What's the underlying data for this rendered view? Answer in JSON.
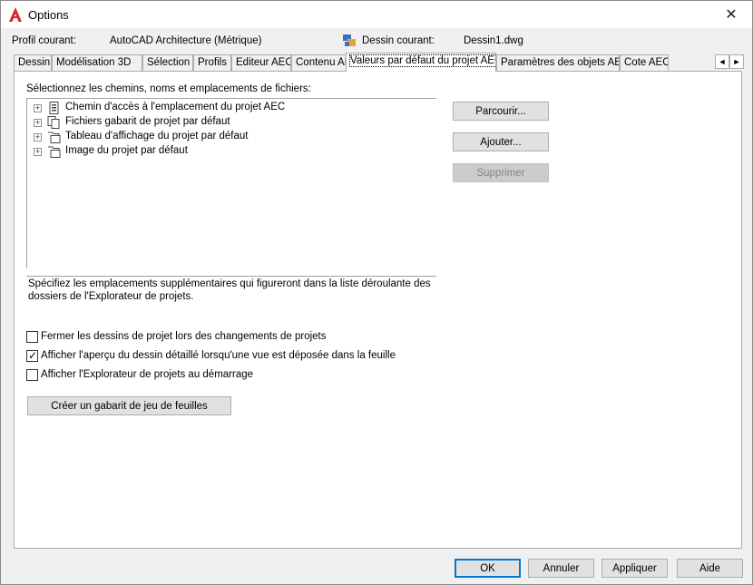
{
  "window": {
    "title": "Options",
    "close_symbol": "✕"
  },
  "profile": {
    "label": "Profil courant:",
    "value": "AutoCAD Architecture (Métrique)"
  },
  "drawing": {
    "label": "Dessin courant:",
    "value": "Dessin1.dwg"
  },
  "tabs": [
    {
      "label": "Dessin"
    },
    {
      "label": "Modélisation 3D"
    },
    {
      "label": "Sélection"
    },
    {
      "label": "Profils"
    },
    {
      "label": "Editeur AEC"
    },
    {
      "label": "Contenu AEC"
    },
    {
      "label": "Valeurs par défaut du projet AEC",
      "active": true
    },
    {
      "label": "Paramètres des objets AEC"
    },
    {
      "label": "Cote AEC"
    }
  ],
  "tab_scroll": {
    "left": "◄",
    "right": "►"
  },
  "paths": {
    "label": "Sélectionnez les chemins, noms et emplacements de fichiers:",
    "items": [
      {
        "label": "Chemin d'accès à l'emplacement du projet AEC",
        "icon": "folder-path-icon"
      },
      {
        "label": "Fichiers gabarit de projet par défaut",
        "icon": "template-files-icon"
      },
      {
        "label": "Tableau d'affichage du projet par défaut",
        "icon": "bulletin-board-icon"
      },
      {
        "label": "Image du projet par défaut",
        "icon": "project-image-icon"
      }
    ],
    "expander": "+"
  },
  "description": "Spécifiez les emplacements supplémentaires qui figureront dans la liste déroulante des dossiers de l'Explorateur de projets.",
  "buttons": {
    "browse": "Parcourir...",
    "add": "Ajouter...",
    "remove": "Supprimer"
  },
  "checkboxes": [
    {
      "label": "Fermer les dessins de projet lors des changements de projets",
      "checked": false
    },
    {
      "label": "Afficher l'aperçu du dessin détaillé lorsqu'une vue est déposée dans la feuille",
      "checked": true
    },
    {
      "label": "Afficher l'Explorateur de projets au démarrage",
      "checked": false
    }
  ],
  "checkmark": "✓",
  "create_template_button": "Créer un gabarit de jeu de feuilles",
  "footer": {
    "ok": "OK",
    "cancel": "Annuler",
    "apply": "Appliquer",
    "help": "Aide"
  },
  "colors": {
    "accent": "#0078d7",
    "autocad_red": "#d6252c"
  }
}
